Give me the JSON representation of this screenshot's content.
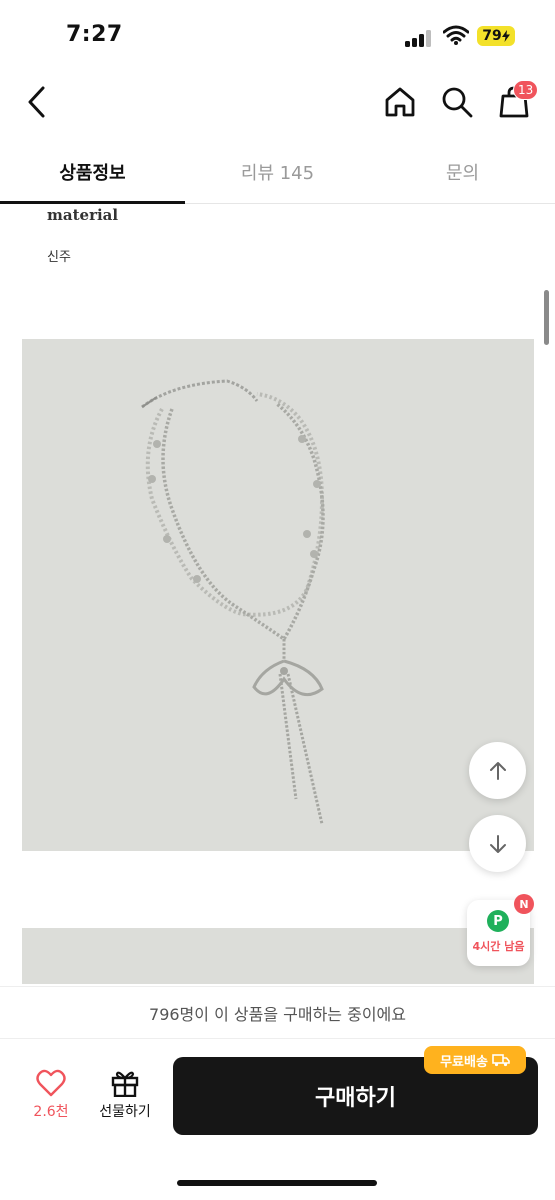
{
  "status_bar": {
    "time": "7:27",
    "battery": "79"
  },
  "header": {
    "cart_count": "13"
  },
  "tabs": [
    {
      "label": "상품정보"
    },
    {
      "label": "리뷰 145"
    },
    {
      "label": "문의"
    }
  ],
  "details": {
    "material_title": "material",
    "material_value": "신주"
  },
  "floating": {
    "point_letter": "P",
    "point_badge": "N",
    "point_text": "4시간 남음"
  },
  "viewer_text": "796명이 이 상품을 구매하는 중이에요",
  "actions": {
    "like_count": "2.6천",
    "gift_label": "선물하기",
    "buy_label": "구매하기",
    "free_shipping": "무료배송"
  },
  "colors": {
    "accent": "#f0545c",
    "buy_bg": "#161616",
    "shipping": "#ffb21e",
    "point": "#1fb05b"
  }
}
